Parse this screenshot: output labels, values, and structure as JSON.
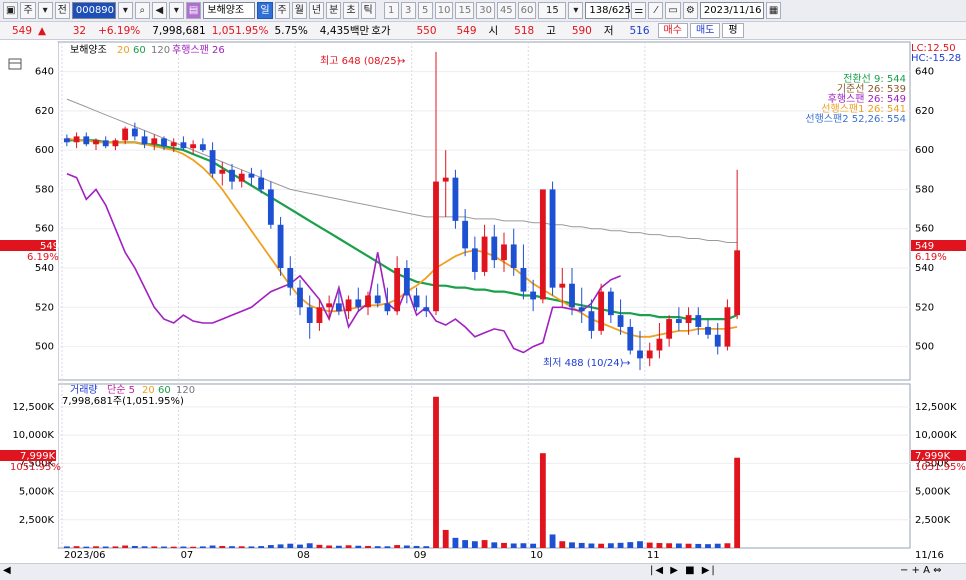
{
  "toolbar": {
    "period_label": "주",
    "field_label": "전",
    "code": "000890",
    "stock_name": "보해양조",
    "periods": [
      "일",
      "주",
      "월",
      "년",
      "분",
      "초",
      "틱"
    ],
    "active_period": "일",
    "minutes": [
      "1",
      "3",
      "5",
      "10",
      "15",
      "30",
      "45",
      "60",
      "15"
    ],
    "count": "138/625",
    "date": "2023/11/16"
  },
  "quote": {
    "price": "549",
    "change": "32",
    "change_pct": "+6.19%",
    "volume": "7,998,681",
    "volume_pct": "1,051.95%",
    "turnover": "5.75%",
    "amount": "4,435백만",
    "ask_label": "호가",
    "ask": "550",
    "last": "549",
    "open_label": "시",
    "open": "518",
    "high_label": "고",
    "high": "590",
    "low_label": "저",
    "low": "516",
    "buy_label": "매수",
    "sell_label": "매도",
    "even_label": "평"
  },
  "price_panel": {
    "legend_name": "보해양조",
    "legend_ma": [
      "20",
      "60",
      "120"
    ],
    "legend_lagging": "후행스팬 26",
    "lc": "LC:12.50",
    "hc": "HC:-15.28",
    "ichimoku": [
      {
        "label": "전환선 9: 544",
        "color": "#1aa04a"
      },
      {
        "label": "기준선 26: 539",
        "color": "#8a5a2a"
      },
      {
        "label": "후행스팬 26: 549",
        "color": "#a020c0"
      },
      {
        "label": "선행스팬1 26: 541",
        "color": "#f0a020"
      },
      {
        "label": "선행스팬2 52,26: 554",
        "color": "#3a70d0"
      }
    ],
    "high_note": "최고 648 (08/25)",
    "low_note": "최저 488 (10/24)",
    "y_ticks": [
      "640",
      "620",
      "600",
      "580",
      "560",
      "540",
      "520",
      "500"
    ],
    "price_tag": "549",
    "price_tag_pct": "6.19%"
  },
  "volume_panel": {
    "legend_name": "거래량",
    "legend_ma": [
      "단순 5",
      "20",
      "60",
      "120"
    ],
    "volume_line": "7,998,681주(1,051.95%)",
    "y_ticks": [
      "12,500K",
      "10,000K",
      "7,500K",
      "5,000K",
      "2,500K"
    ],
    "vol_tag": "7,999K",
    "vol_tag_pct": "1051.95%"
  },
  "x_axis": {
    "labels": [
      "2023/06",
      "07",
      "08",
      "09",
      "10",
      "11"
    ],
    "right_label": "11/16"
  },
  "colors": {
    "up": "#e0141e",
    "down": "#1e50d2",
    "ma20": "#f0a020",
    "ma60": "#1aa04a",
    "ma120": "#9a9a9a",
    "lagging": "#a020c0"
  },
  "chart_data": {
    "type": "candlestick",
    "y_range": [
      484,
      652
    ],
    "volume_range": [
      0,
      14000
    ],
    "candles": [
      [
        606,
        608,
        602,
        604
      ],
      [
        604,
        609,
        601,
        607
      ],
      [
        607,
        609,
        602,
        603
      ],
      [
        603,
        606,
        600,
        605
      ],
      [
        605,
        607,
        601,
        602
      ],
      [
        602,
        606,
        600,
        605
      ],
      [
        605,
        612,
        603,
        611
      ],
      [
        611,
        614,
        605,
        607
      ],
      [
        607,
        610,
        601,
        603
      ],
      [
        603,
        608,
        600,
        606
      ],
      [
        606,
        607,
        600,
        602
      ],
      [
        602,
        606,
        599,
        604
      ],
      [
        604,
        607,
        600,
        601
      ],
      [
        601,
        605,
        598,
        603
      ],
      [
        603,
        606,
        599,
        600
      ],
      [
        600,
        604,
        586,
        588
      ],
      [
        588,
        594,
        582,
        590
      ],
      [
        590,
        593,
        580,
        584
      ],
      [
        584,
        590,
        581,
        588
      ],
      [
        588,
        591,
        582,
        586
      ],
      [
        586,
        590,
        578,
        580
      ],
      [
        580,
        584,
        560,
        562
      ],
      [
        562,
        566,
        536,
        540
      ],
      [
        540,
        546,
        526,
        530
      ],
      [
        530,
        534,
        516,
        520
      ],
      [
        520,
        526,
        504,
        512
      ],
      [
        512,
        524,
        508,
        520
      ],
      [
        520,
        526,
        514,
        522
      ],
      [
        522,
        528,
        516,
        518
      ],
      [
        518,
        526,
        514,
        524
      ],
      [
        524,
        530,
        518,
        520
      ],
      [
        520,
        528,
        516,
        526
      ],
      [
        526,
        532,
        520,
        522
      ],
      [
        522,
        530,
        516,
        518
      ],
      [
        518,
        546,
        516,
        540
      ],
      [
        540,
        544,
        522,
        526
      ],
      [
        526,
        530,
        518,
        520
      ],
      [
        520,
        526,
        515,
        518
      ],
      [
        518,
        650,
        516,
        584
      ],
      [
        584,
        600,
        566,
        586
      ],
      [
        586,
        590,
        560,
        564
      ],
      [
        564,
        570,
        546,
        550
      ],
      [
        550,
        556,
        534,
        538
      ],
      [
        538,
        562,
        536,
        556
      ],
      [
        556,
        562,
        540,
        544
      ],
      [
        544,
        558,
        538,
        552
      ],
      [
        552,
        560,
        536,
        540
      ],
      [
        540,
        552,
        524,
        528
      ],
      [
        528,
        534,
        518,
        524
      ],
      [
        524,
        566,
        522,
        580
      ],
      [
        580,
        584,
        526,
        530
      ],
      [
        530,
        540,
        520,
        532
      ],
      [
        532,
        540,
        516,
        520
      ],
      [
        520,
        530,
        512,
        518
      ],
      [
        518,
        524,
        504,
        508
      ],
      [
        508,
        532,
        506,
        528
      ],
      [
        528,
        530,
        512,
        516
      ],
      [
        516,
        524,
        506,
        510
      ],
      [
        510,
        514,
        496,
        498
      ],
      [
        498,
        508,
        488,
        494
      ],
      [
        494,
        502,
        490,
        498
      ],
      [
        498,
        512,
        494,
        504
      ],
      [
        504,
        516,
        500,
        514
      ],
      [
        514,
        520,
        508,
        512
      ],
      [
        512,
        520,
        506,
        516
      ],
      [
        516,
        520,
        506,
        510
      ],
      [
        510,
        514,
        504,
        506
      ],
      [
        506,
        512,
        496,
        500
      ],
      [
        500,
        524,
        498,
        520
      ],
      [
        516,
        590,
        514,
        549
      ]
    ],
    "volumes": [
      140,
      160,
      120,
      150,
      130,
      140,
      220,
      180,
      150,
      140,
      130,
      120,
      130,
      110,
      140,
      220,
      180,
      160,
      150,
      140,
      170,
      260,
      320,
      380,
      300,
      420,
      280,
      220,
      200,
      240,
      200,
      180,
      160,
      150,
      260,
      220,
      180,
      160,
      13400,
      1600,
      900,
      700,
      600,
      700,
      500,
      450,
      400,
      420,
      380,
      8400,
      1200,
      600,
      500,
      450,
      400,
      380,
      420,
      460,
      520,
      600,
      480,
      440,
      420,
      400,
      380,
      360,
      340,
      380,
      420,
      7999
    ],
    "ma20": [
      606,
      605,
      605,
      604,
      604,
      604,
      604,
      604,
      603,
      602,
      601,
      600,
      598,
      595,
      591,
      586,
      580,
      573,
      566,
      559,
      552,
      545,
      538,
      531,
      525,
      521,
      519,
      518,
      518,
      519,
      520,
      521,
      521,
      522,
      524,
      528,
      531,
      535,
      540,
      543,
      546,
      548,
      549,
      548,
      546,
      543,
      540,
      536,
      532,
      529,
      526,
      523,
      520,
      517,
      514,
      512,
      510,
      508,
      506,
      505,
      505,
      506,
      507,
      508,
      508,
      509,
      509,
      509,
      509,
      510
    ],
    "ma60": [
      605,
      605,
      605,
      605,
      604,
      604,
      604,
      604,
      603,
      603,
      602,
      601,
      600,
      598,
      596,
      594,
      591,
      588,
      585,
      582,
      579,
      576,
      573,
      570,
      567,
      564,
      561,
      558,
      555,
      552,
      549,
      546,
      543,
      540,
      537,
      535,
      533,
      532,
      531,
      531,
      530,
      530,
      529,
      529,
      528,
      528,
      527,
      526,
      526,
      525,
      524,
      523,
      522,
      521,
      520,
      519,
      518,
      517,
      517,
      516,
      516,
      515,
      515,
      515,
      514,
      514,
      514,
      514,
      514,
      516
    ],
    "ma120": [
      626,
      624,
      622,
      620,
      618,
      616,
      614,
      612,
      610,
      608,
      606,
      604,
      602,
      600,
      598,
      596,
      594,
      592,
      590,
      588,
      586,
      584,
      582,
      580,
      579,
      578,
      577,
      576,
      575,
      574,
      573,
      572,
      571,
      570,
      569,
      568,
      567,
      566,
      566,
      566,
      566,
      566,
      565,
      565,
      565,
      564,
      564,
      564,
      563,
      563,
      562,
      562,
      561,
      561,
      560,
      560,
      559,
      559,
      558,
      558,
      557,
      557,
      556,
      556,
      555,
      555,
      554,
      554,
      553,
      553
    ],
    "lagging": [
      588,
      586,
      575,
      580,
      572,
      560,
      548,
      540,
      530,
      520,
      514,
      512,
      516,
      513,
      512,
      512,
      514,
      516,
      518,
      520,
      524,
      528,
      530,
      532,
      536,
      530,
      524,
      514,
      530,
      510,
      518,
      522,
      548,
      522,
      518,
      530,
      516,
      520,
      513,
      511,
      514,
      510,
      505,
      507,
      509,
      508,
      499,
      497,
      500,
      502,
      520,
      520,
      519,
      518,
      522,
      530,
      534,
      536
    ]
  }
}
